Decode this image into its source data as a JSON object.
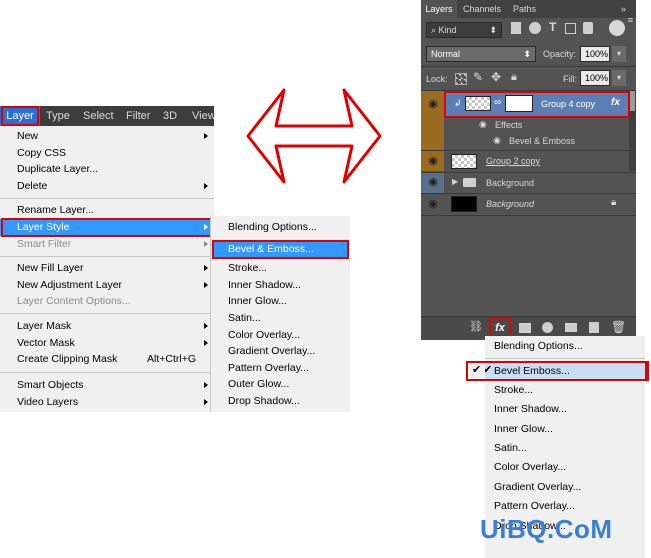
{
  "menubar": {
    "items": [
      "Layer",
      "Type",
      "Select",
      "Filter",
      "3D",
      "View"
    ]
  },
  "layer_menu": {
    "items": [
      {
        "label": "New",
        "shortcut": ""
      },
      {
        "label": "Copy CSS",
        "shortcut": ""
      },
      {
        "label": "Duplicate Layer...",
        "shortcut": ""
      },
      {
        "label": "Delete",
        "shortcut": ""
      },
      {
        "label": "Rename Layer...",
        "shortcut": ""
      },
      {
        "label": "Layer Style",
        "shortcut": ""
      },
      {
        "label": "Smart Filter",
        "shortcut": ""
      },
      {
        "label": "New Fill Layer",
        "shortcut": ""
      },
      {
        "label": "New Adjustment Layer",
        "shortcut": ""
      },
      {
        "label": "Layer Content Options...",
        "shortcut": ""
      },
      {
        "label": "Layer Mask",
        "shortcut": ""
      },
      {
        "label": "Vector Mask",
        "shortcut": ""
      },
      {
        "label": "Create Clipping Mask",
        "shortcut": "Alt+Ctrl+G"
      },
      {
        "label": "Smart Objects",
        "shortcut": ""
      },
      {
        "label": "Video Layers",
        "shortcut": ""
      }
    ]
  },
  "layer_style_submenu": {
    "items": [
      "Blending Options...",
      "Bevel & Emboss...",
      "Stroke...",
      "Inner Shadow...",
      "Inner Glow...",
      "Satin...",
      "Color Overlay...",
      "Gradient Overlay...",
      "Pattern Overlay...",
      "Outer Glow...",
      "Drop Shadow..."
    ]
  },
  "layers_panel": {
    "tabs": [
      "Layers",
      "Channels",
      "Paths"
    ],
    "filter_kind": "Kind",
    "blend_mode": "Normal",
    "opacity_label": "Opacity:",
    "opacity_value": "100%",
    "lock_label": "Lock:",
    "fill_label": "Fill:",
    "fill_value": "100%",
    "layers": [
      "Group 4 copy",
      "Effects",
      "Bevel & Emboss",
      "Group 2 copy",
      "Background",
      "Background"
    ],
    "fx_label": "fx"
  },
  "fx_dropdown": {
    "items": [
      "Blending Options...",
      "Bevel  Emboss...",
      "Stroke...",
      "Inner Shadow...",
      "Inner Glow...",
      "Satin...",
      "Color Overlay...",
      "Gradient Overlay...",
      "Pattern Overlay...",
      "Drop Shadow..."
    ]
  },
  "watermark": "UiBQ.CoM",
  "colors": {
    "highlight": "#3399ff",
    "annotation_red": "#e00000",
    "panel_bg": "#535353",
    "selected_layer": "#5b7fb5",
    "eye_column": "#9a6a1e"
  }
}
